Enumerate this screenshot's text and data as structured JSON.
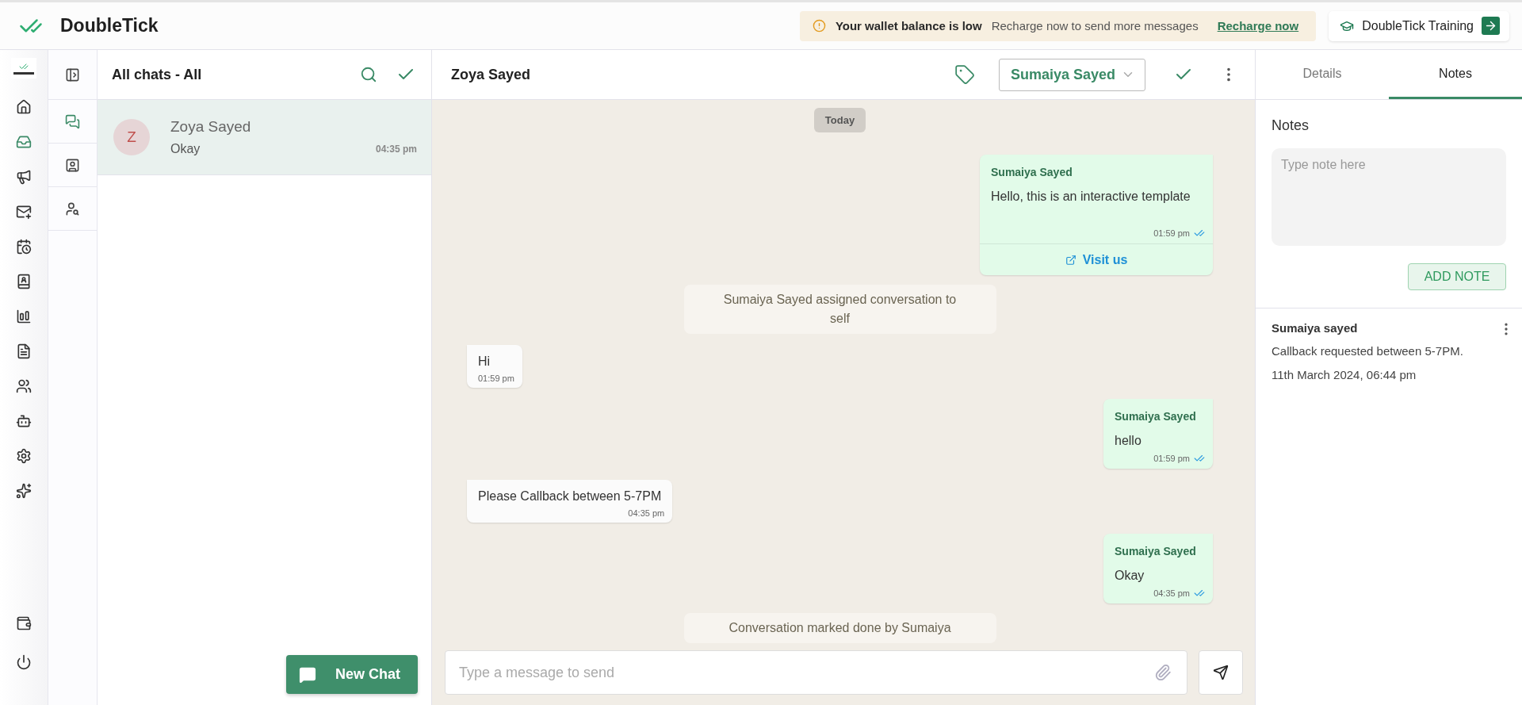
{
  "top_bar": {
    "brand": "DoubleTick",
    "alert": {
      "title": "Your wallet balance is low",
      "message": "Recharge now to send more messages",
      "link": "Recharge now"
    },
    "training_button": "DoubleTick Training"
  },
  "nav_items": [
    {
      "selected": false
    },
    {
      "selected": true
    },
    {
      "selected": false
    },
    {
      "selected": false
    },
    {
      "selected": false
    },
    {
      "selected": false
    },
    {
      "selected": false
    },
    {
      "selected": false
    },
    {
      "selected": false
    },
    {
      "selected": false
    },
    {
      "selected": false
    },
    {
      "selected": false
    }
  ],
  "nav_bottom": [
    {
      "selected": false
    },
    {
      "selected": false
    }
  ],
  "sub_nav": [
    {
      "selected": true
    },
    {
      "selected": false
    },
    {
      "selected": false
    }
  ],
  "chat_list": {
    "title": "All chats - All",
    "chats": [
      {
        "initial": "Z",
        "name": "Zoya Sayed",
        "preview": "Okay",
        "time": "04:35 pm",
        "selected": true
      }
    ],
    "new_chat_button": "New Chat"
  },
  "chat": {
    "contact_name": "Zoya Sayed",
    "assignee": "Sumaiya Sayed",
    "date_pill": "Today",
    "messages": [
      {
        "kind": "template",
        "sender": "Sumaiya Sayed",
        "text": "Hello, this is an interactive template",
        "time": "01:59 pm",
        "read": true,
        "button": "Visit us"
      },
      {
        "kind": "system",
        "text": "Sumaiya Sayed assigned conversation to self"
      },
      {
        "kind": "incoming",
        "text": "Hi",
        "time": "01:59 pm"
      },
      {
        "kind": "outgoing",
        "sender": "Sumaiya Sayed",
        "text": "hello",
        "time": "01:59 pm",
        "read": true
      },
      {
        "kind": "incoming",
        "text": "Please Callback between 5-7PM",
        "time": "04:35 pm"
      },
      {
        "kind": "outgoing",
        "sender": "Sumaiya Sayed",
        "text": "Okay",
        "time": "04:35 pm",
        "read": true
      },
      {
        "kind": "system",
        "text": "Conversation marked done by Sumaiya"
      }
    ],
    "composer_placeholder": "Type a message to send"
  },
  "right_panel": {
    "tabs": [
      {
        "label": "Details",
        "selected": false
      },
      {
        "label": "Notes",
        "selected": true
      }
    ],
    "notes_title": "Notes",
    "note_placeholder": "Type note here",
    "add_note_button": "ADD NOTE",
    "notes": [
      {
        "author": "Sumaiya sayed",
        "text": "Callback requested between 5-7PM.",
        "date": "11th March 2024, 06:44 pm"
      }
    ]
  }
}
